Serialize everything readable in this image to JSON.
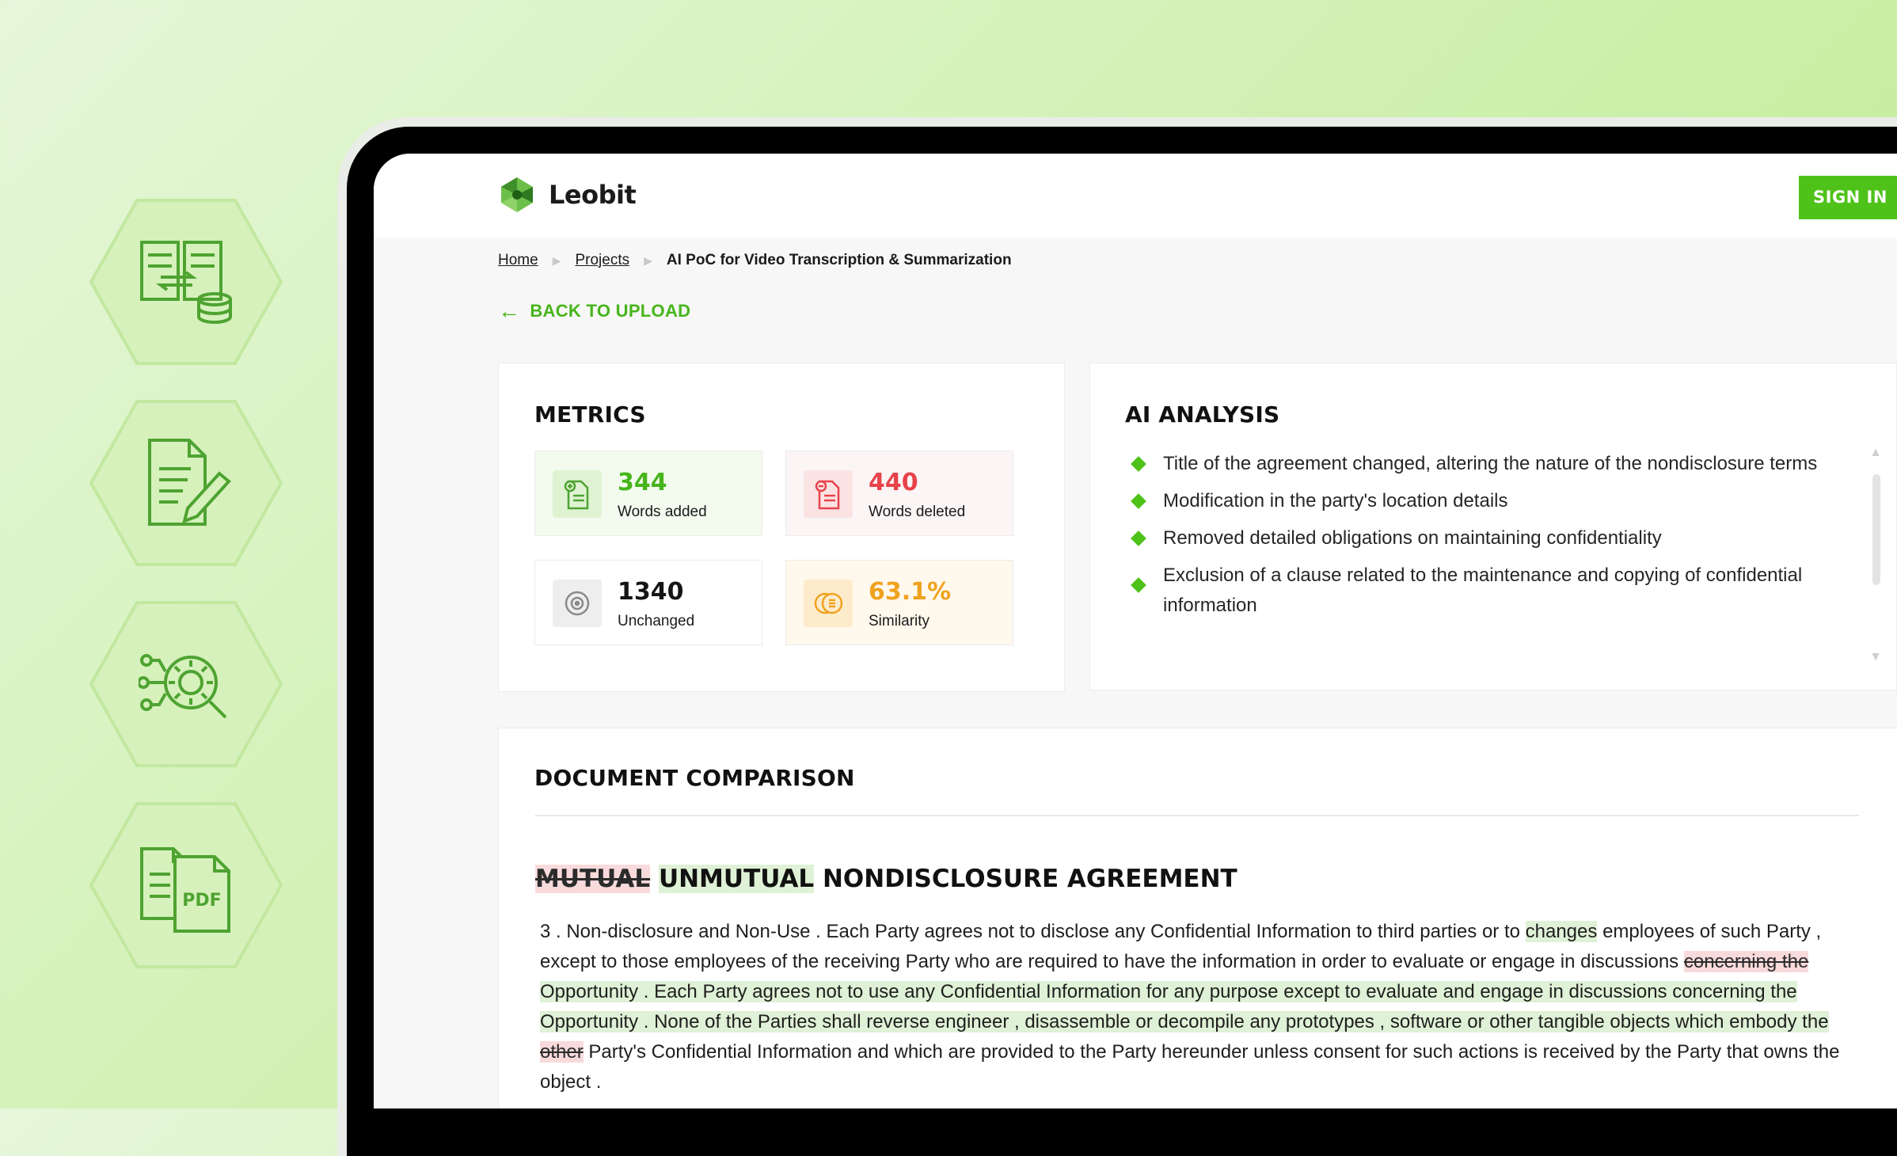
{
  "brand": {
    "name": "Leobit",
    "accent": "#4fc21a"
  },
  "side_icons": [
    "document-database-icon",
    "document-edit-icon",
    "ai-gear-search-icon",
    "pdf-document-icon"
  ],
  "pdf_label": "PDF",
  "header": {
    "sign_in": "SIGN IN"
  },
  "breadcrumb": {
    "home": "Home",
    "projects": "Projects",
    "current": "AI PoC for Video Transcription & Summarization"
  },
  "back": {
    "label": "BACK TO UPLOAD"
  },
  "metrics": {
    "title": "METRICS",
    "items": [
      {
        "value": "344",
        "label": "Words added",
        "color": "#46b51a",
        "icon": "document-add-icon"
      },
      {
        "value": "440",
        "label": "Words deleted",
        "color": "#e8424b",
        "icon": "document-remove-icon"
      },
      {
        "value": "1340",
        "label": "Unchanged",
        "color": "#151515",
        "icon": "target-icon"
      },
      {
        "value": "63.1%",
        "label": "Similarity",
        "color": "#f0a21e",
        "icon": "coins-icon"
      }
    ]
  },
  "ai": {
    "title": "AI ANALYSIS",
    "items": [
      "Title of the agreement changed, altering the nature of the nondisclosure terms",
      "Modification in the party's location details",
      "Removed detailed obligations on maintaining confidentiality",
      "Exclusion of a clause related to the maintenance and copying of confidential information"
    ]
  },
  "comparison": {
    "title": "DOCUMENT COMPARISON",
    "heading": {
      "deleted": "MUTUAL",
      "inserted": "UNMUTUAL",
      "rest": "NONDISCLOSURE AGREEMENT"
    },
    "p1": "3 . Non-disclosure and Non-Use . Each Party agrees not to disclose any Confidential Information to third parties or to",
    "p1_ins": "changes",
    "p2": "employees of such Party , except to those employees of the receiving Party who are required to have the information in order to evaluate or engage in discussions",
    "p2_del": "concerning the",
    "p3_ins": "Opportunity . Each Party agrees not to use any Confidential Information for any purpose except to evaluate and engage in discussions concerning the Opportunity . None of the Parties shall reverse engineer , disassemble or decompile any prototypes , software or other tangible objects which embody the",
    "p4_del": "other",
    "p4": "Party's Confidential Information and which are provided to the Party hereunder unless consent for such actions is received by the Party that owns the object ."
  }
}
